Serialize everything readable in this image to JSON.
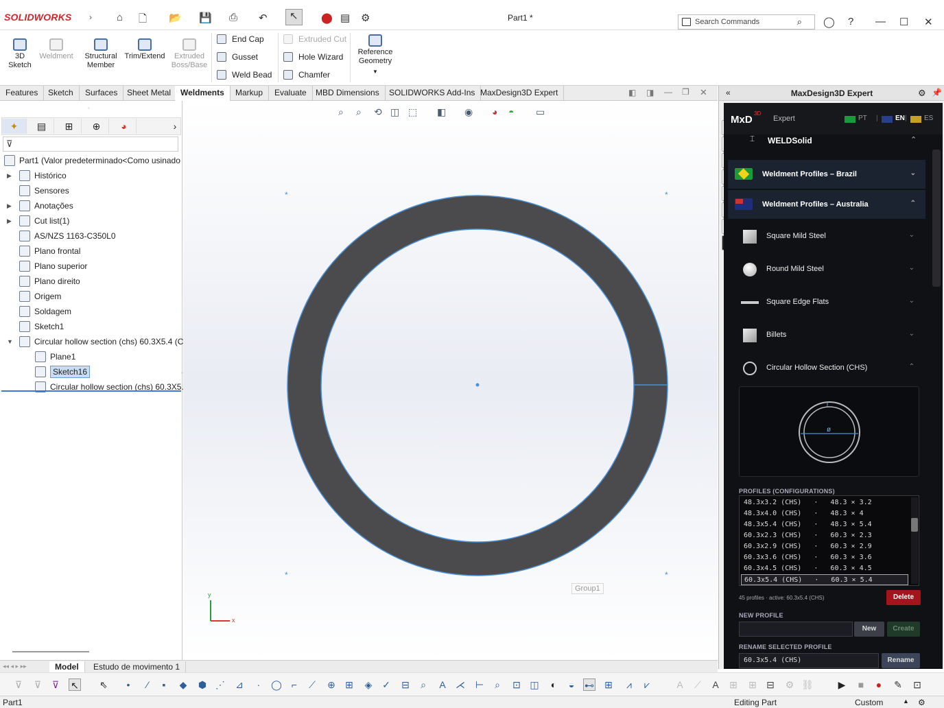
{
  "app": {
    "brand": "SOLIDWORKS",
    "document_title": "Part1 *"
  },
  "search": {
    "placeholder": "Search Commands"
  },
  "ribbon": {
    "large": [
      {
        "label": "3D\nSketch",
        "enabled": true
      },
      {
        "label": "Weldment",
        "enabled": false
      },
      {
        "label": "Structural\nMember",
        "enabled": true
      },
      {
        "label": "Trim/Extend",
        "enabled": true
      },
      {
        "label": "Extruded\nBoss/Base",
        "enabled": false
      }
    ],
    "small_col1": [
      "End Cap",
      "Gusset",
      "Weld Bead"
    ],
    "small_col2": [
      "Extruded Cut",
      "Hole Wizard",
      "Chamfer"
    ],
    "reference": "Reference\nGeometry"
  },
  "tabs": [
    "Features",
    "Sketch",
    "Surfaces",
    "Sheet Metal",
    "Weldments",
    "Markup",
    "Evaluate",
    "MBD Dimensions",
    "SOLIDWORKS Add-Ins",
    "MaxDesign3D Expert"
  ],
  "active_tab": "Weldments",
  "tree": [
    {
      "label": "Part1  (Valor predeterminado<Como usinado",
      "icon": "part-icon",
      "indent": 0,
      "toggle": ""
    },
    {
      "label": "Histórico",
      "icon": "history-icon",
      "indent": 1,
      "toggle": "▶"
    },
    {
      "label": "Sensores",
      "icon": "sensors-icon",
      "indent": 1,
      "toggle": ""
    },
    {
      "label": "Anotações",
      "icon": "annotations-icon",
      "indent": 1,
      "toggle": "▶"
    },
    {
      "label": "Cut list(1)",
      "icon": "cut-list-icon",
      "indent": 1,
      "toggle": "▶"
    },
    {
      "label": "AS/NZS 1163-C350L0",
      "icon": "material-icon",
      "indent": 1,
      "toggle": ""
    },
    {
      "label": "Plano frontal",
      "icon": "plane-icon",
      "indent": 1,
      "toggle": ""
    },
    {
      "label": "Plano superior",
      "icon": "plane-icon",
      "indent": 1,
      "toggle": ""
    },
    {
      "label": "Plano direito",
      "icon": "plane-icon",
      "indent": 1,
      "toggle": ""
    },
    {
      "label": "Origem",
      "icon": "origin-icon",
      "indent": 1,
      "toggle": ""
    },
    {
      "label": "Soldagem",
      "icon": "weldment-icon",
      "indent": 1,
      "toggle": ""
    },
    {
      "label": "Sketch1",
      "icon": "sketch-icon",
      "indent": 1,
      "toggle": ""
    },
    {
      "label": "Circular hollow section (chs) 60.3X5.4 (C",
      "icon": "structural-member-icon",
      "indent": 1,
      "toggle": "▼"
    },
    {
      "label": "Plane1",
      "icon": "plane-icon",
      "indent": 2,
      "toggle": ""
    },
    {
      "label": "Sketch16",
      "icon": "sketch-icon",
      "indent": 2,
      "toggle": "",
      "selected": true
    },
    {
      "label": "Circular hollow section (chs) 60.3X5.",
      "icon": "body-icon",
      "indent": 2,
      "toggle": ""
    }
  ],
  "viewport": {
    "group_label": "Group1",
    "axis_x": "x",
    "axis_y": "y"
  },
  "rpanel": {
    "title": "MaxDesign3D Expert"
  },
  "mxd": {
    "logo": "MxD",
    "logo_sup": "3D",
    "subtitle": "Expert",
    "langs": [
      "PT",
      "EN",
      "ES"
    ],
    "active_lang": "EN",
    "weldsolid": "WELDSolid",
    "sections": [
      {
        "label": "Weldment Profiles – Brazil",
        "flag": "brazil-flag-icon",
        "chev": "⌄"
      },
      {
        "label": "Weldment Profiles – Australia",
        "flag": "australia-flag-icon",
        "chev": "⌃"
      }
    ],
    "items": [
      {
        "label": "Square Mild Steel",
        "icon": "square-icon",
        "chev": "⌄"
      },
      {
        "label": "Round Mild Steel",
        "icon": "round-icon",
        "chev": "⌄"
      },
      {
        "label": "Square Edge Flats",
        "icon": "flat-icon",
        "chev": "⌄"
      },
      {
        "label": "Billets",
        "icon": "billet-icon",
        "chev": "⌄"
      },
      {
        "label": "Circular Hollow Section (CHS)",
        "icon": "chs-icon",
        "chev": "⌃"
      }
    ],
    "preview_dim": "ø",
    "preview_t": "t",
    "profiles_label": "PROFILES (CONFIGURATIONS)",
    "profiles": [
      "48.3x3.2 (CHS)   ·   48.3 × 3.2",
      "48.3x4.0 (CHS)   ·   48.3 × 4",
      "48.3x5.4 (CHS)   ·   48.3 × 5.4",
      "60.3x2.3 (CHS)   ·   60.3 × 2.3",
      "60.3x2.9 (CHS)   ·   60.3 × 2.9",
      "60.3x3.6 (CHS)   ·   60.3 × 3.6",
      "60.3x4.5 (CHS)   ·   60.3 × 4.5",
      "60.3x5.4 (CHS)   ·   60.3 × 5.4"
    ],
    "active_profile_index": 7,
    "summary": "45 profiles · active: 60.3x5.4 (CHS)",
    "delete_label": "Delete",
    "new_profile_label": "NEW PROFILE",
    "new_profile_value": "",
    "new_label": "New",
    "create_label": "Create",
    "rename_label": "RENAME SELECTED PROFILE",
    "rename_value": "60.3x5.4 (CHS)",
    "rename_btn": "Rename"
  },
  "bottom_tabs": [
    "Model",
    "Estudo de movimento 1"
  ],
  "status": {
    "left": "Part1",
    "mode": "Editing Part",
    "units": "Custom"
  },
  "colors": {
    "accent": "#4a90d9",
    "section_dark": "#101114",
    "delete": "#a3141c",
    "profile_fill": "#4b4b4d"
  }
}
